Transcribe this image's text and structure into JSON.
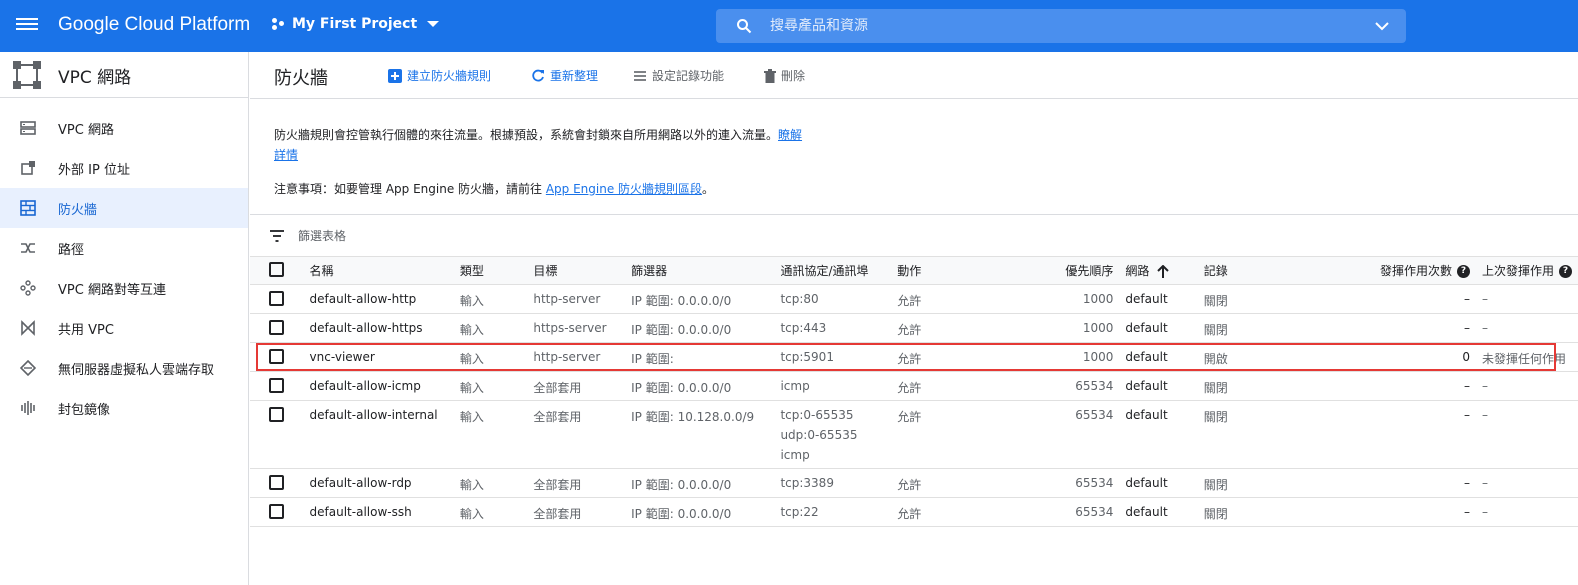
{
  "topbar": {
    "brand": "Google Cloud Platform",
    "project": "My First Project",
    "search_placeholder": "搜尋產品和資源"
  },
  "sidebar": {
    "title": "VPC 網路",
    "items": [
      {
        "label": "VPC 網路",
        "icon": "vpc-network-icon",
        "active": false
      },
      {
        "label": "外部 IP 位址",
        "icon": "external-ip-icon",
        "active": false
      },
      {
        "label": "防火牆",
        "icon": "firewall-icon",
        "active": true
      },
      {
        "label": "路徑",
        "icon": "routes-icon",
        "active": false
      },
      {
        "label": "VPC 網路對等互連",
        "icon": "peering-icon",
        "active": false
      },
      {
        "label": "共用 VPC",
        "icon": "shared-vpc-icon",
        "active": false
      },
      {
        "label": "無伺服器虛擬私人雲端存取",
        "icon": "serverless-icon",
        "active": false
      },
      {
        "label": "封包鏡像",
        "icon": "packet-mirroring-icon",
        "active": false
      }
    ]
  },
  "toolbar": {
    "title": "防火牆",
    "create": "建立防火牆規則",
    "refresh": "重新整理",
    "logs": "設定記錄功能",
    "delete": "刪除"
  },
  "description": {
    "text": "防火牆規則會控管執行個體的來往流量。根據預設，系統會封鎖來自所用網路以外的連入流量。",
    "learn_more": "瞭解詳情",
    "note_prefix": "注意事項：如要管理 App Engine 防火牆，請前往",
    "note_link": "App Engine 防火牆規則區段",
    "note_suffix": "。"
  },
  "filter": {
    "placeholder": "篩選表格"
  },
  "table": {
    "headers": {
      "name": "名稱",
      "type": "類型",
      "target": "目標",
      "filter": "篩選器",
      "protocol": "通訊協定/通訊埠",
      "action": "動作",
      "priority": "優先順序",
      "network": "網路",
      "logs": "記錄",
      "hit_count": "發揮作用次數",
      "last_hit": "上次發揮作用"
    },
    "rows": [
      {
        "name": "default-allow-http",
        "type": "輸入",
        "target": "http-server",
        "filter": "IP 範圍: 0.0.0.0/0",
        "protocol": [
          "tcp:80"
        ],
        "action": "允許",
        "priority": "1000",
        "network": "default",
        "logs": "關閉",
        "hit_count": "–",
        "last_hit": "–"
      },
      {
        "name": "default-allow-https",
        "type": "輸入",
        "target": "https-server",
        "filter": "IP 範圍: 0.0.0.0/0",
        "protocol": [
          "tcp:443"
        ],
        "action": "允許",
        "priority": "1000",
        "network": "default",
        "logs": "關閉",
        "hit_count": "–",
        "last_hit": "–"
      },
      {
        "name": "vnc-viewer",
        "type": "輸入",
        "target": "http-server",
        "filter": "IP 範圍:",
        "protocol": [
          "tcp:5901"
        ],
        "action": "允許",
        "priority": "1000",
        "network": "default",
        "logs": "開啟",
        "hit_count": "0",
        "last_hit": "未發揮任何作用"
      },
      {
        "name": "default-allow-icmp",
        "type": "輸入",
        "target": "全部套用",
        "filter": "IP 範圍: 0.0.0.0/0",
        "protocol": [
          "icmp"
        ],
        "action": "允許",
        "priority": "65534",
        "network": "default",
        "logs": "關閉",
        "hit_count": "–",
        "last_hit": "–"
      },
      {
        "name": "default-allow-internal",
        "type": "輸入",
        "target": "全部套用",
        "filter": "IP 範圍: 10.128.0.0/9",
        "protocol": [
          "tcp:0-65535",
          "udp:0-65535",
          "icmp"
        ],
        "action": "允許",
        "priority": "65534",
        "network": "default",
        "logs": "關閉",
        "hit_count": "–",
        "last_hit": "–"
      },
      {
        "name": "default-allow-rdp",
        "type": "輸入",
        "target": "全部套用",
        "filter": "IP 範圍: 0.0.0.0/0",
        "protocol": [
          "tcp:3389"
        ],
        "action": "允許",
        "priority": "65534",
        "network": "default",
        "logs": "關閉",
        "hit_count": "–",
        "last_hit": "–"
      },
      {
        "name": "default-allow-ssh",
        "type": "輸入",
        "target": "全部套用",
        "filter": "IP 範圍: 0.0.0.0/0",
        "protocol": [
          "tcp:22"
        ],
        "action": "允許",
        "priority": "65534",
        "network": "default",
        "logs": "關閉",
        "hit_count": "–",
        "last_hit": "–"
      }
    ]
  },
  "colors": {
    "primary": "#1a73e8",
    "highlight": "#e53935",
    "active_bg": "#e8f0fe"
  }
}
